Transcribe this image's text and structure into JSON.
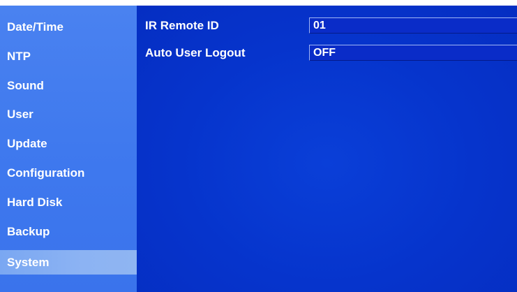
{
  "sidebar": {
    "items": [
      {
        "label": "Date/Time"
      },
      {
        "label": "NTP"
      },
      {
        "label": "Sound"
      },
      {
        "label": "User"
      },
      {
        "label": "Update"
      },
      {
        "label": "Configuration"
      },
      {
        "label": "Hard Disk"
      },
      {
        "label": "Backup"
      },
      {
        "label": "System"
      }
    ],
    "selected": "System"
  },
  "settings": {
    "ir_remote_id": {
      "label": "IR Remote ID",
      "value": "01"
    },
    "auto_user_logout": {
      "label": "Auto User Logout",
      "value": "OFF"
    }
  },
  "colors": {
    "sidebar_bg": "#4a82f0",
    "selected_item": "#8cb3f3",
    "main_bg": "#0634cc",
    "field_bg": "#0a2cc8",
    "text": "#ffffff"
  }
}
